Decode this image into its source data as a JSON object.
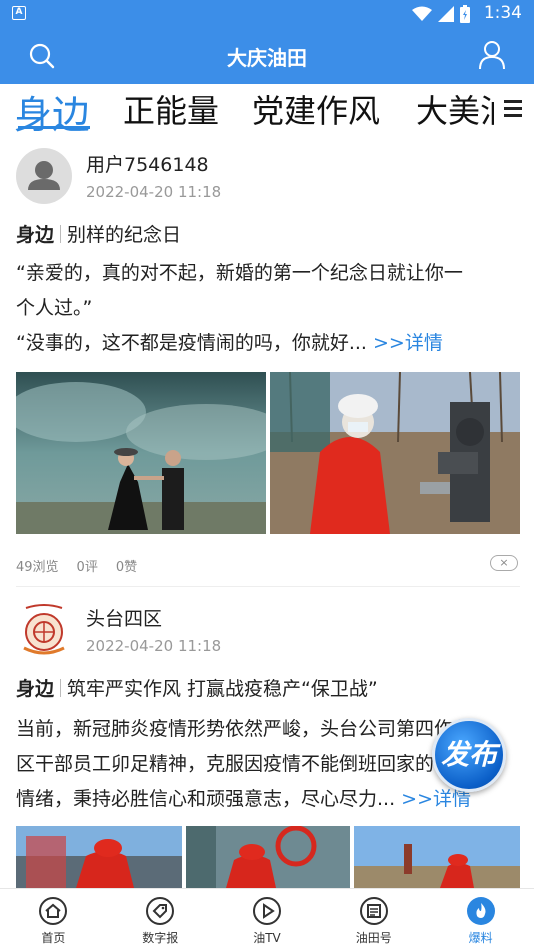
{
  "status_bar": {
    "time": "1:34",
    "app_badge": "A"
  },
  "header": {
    "title": "大庆油田"
  },
  "tabs": [
    {
      "label": "身边",
      "active": true
    },
    {
      "label": "正能量",
      "active": false
    },
    {
      "label": "党建作风",
      "active": false
    },
    {
      "label": "大美油",
      "active": false
    }
  ],
  "posts": [
    {
      "username": "用户7546148",
      "time": "2022-04-20 11:18",
      "tag": "身边",
      "title": "别样的纪念日",
      "body_lines": [
        "“亲爱的，真的对不起，新婚的第一个纪念日就让你一",
        "个人过。”",
        "“没事的，这不都是疫情闹的吗，你就好..."
      ],
      "more": ">>详情",
      "stats": {
        "views": "49浏览",
        "comments": "0评",
        "likes": "0赞"
      },
      "close_label": "×"
    },
    {
      "username": "头台四区",
      "time": "2022-04-20 11:18",
      "tag": "身边",
      "title": "筑牢严实作风  打赢战疫稳产“保卫战”",
      "body_lines": [
        "当前，新冠肺炎疫情形势依然严峻，头台公司第四作业",
        "区干部员工卯足精神，克服因疫情不能倒班回家的不良",
        "情绪，秉持必胜信心和顽强意志，尽心尽力..."
      ],
      "more": ">>详情"
    }
  ],
  "fab": {
    "label": "发布"
  },
  "bottom_nav": [
    {
      "label": "首页",
      "icon": "home-icon",
      "active": false
    },
    {
      "label": "数字报",
      "icon": "tag-icon",
      "active": false
    },
    {
      "label": "油TV",
      "icon": "play-icon",
      "active": false
    },
    {
      "label": "油田号",
      "icon": "newspaper-icon",
      "active": false
    },
    {
      "label": "爆料",
      "icon": "fire-icon",
      "active": true
    }
  ],
  "colors": {
    "primary": "#3c8ee8",
    "accent": "#2a86e0"
  }
}
